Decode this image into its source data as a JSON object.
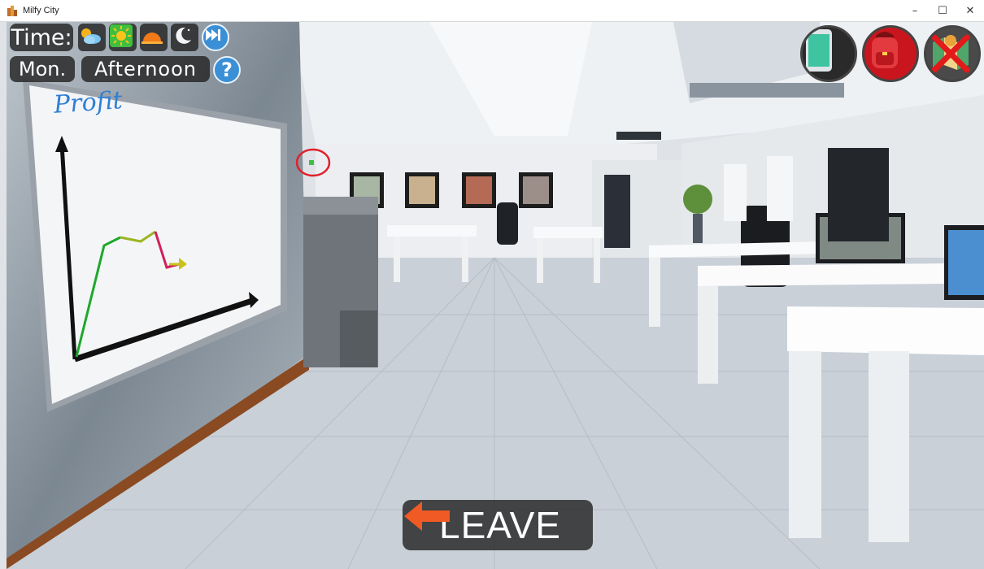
{
  "window": {
    "title": "Milfy City",
    "controls": {
      "minimize": "–",
      "maximize": "☐",
      "close": "✕"
    }
  },
  "hud": {
    "time_label": "Time:",
    "day": "Mon.",
    "period": "Afternoon",
    "help": "?",
    "time_icons": [
      "morning-icon",
      "day-sun-icon",
      "evening-sunset-icon",
      "night-moon-icon",
      "skip-forward-icon"
    ],
    "right_buttons": [
      "phone-icon",
      "backpack-icon",
      "map-disabled-icon"
    ]
  },
  "scene": {
    "whiteboard_text": "Profit"
  },
  "leave": {
    "label": "LEAVE"
  },
  "colors": {
    "leave_arrow": "#f05a24",
    "help_blue": "#3a8fd6",
    "hud_bg": "#282828"
  }
}
